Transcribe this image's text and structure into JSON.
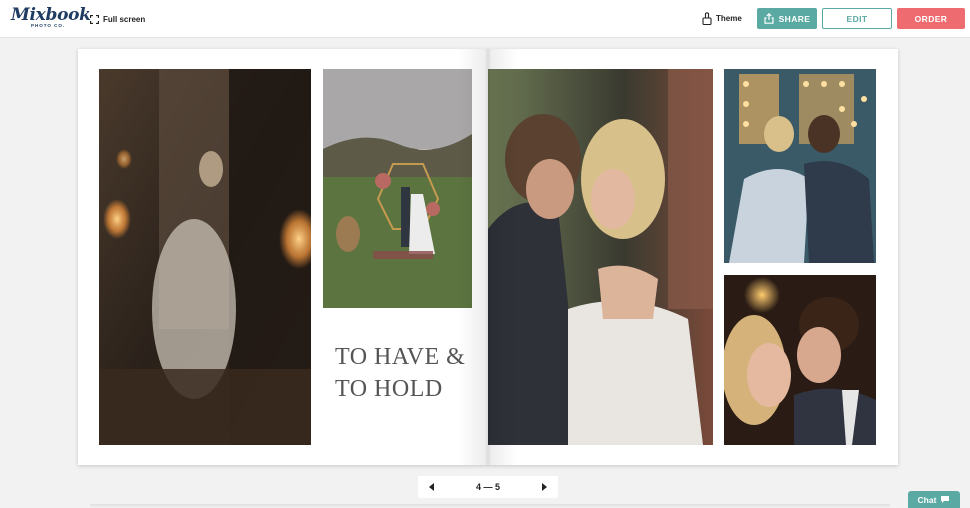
{
  "brand": {
    "logo_text": "Mixbook",
    "logo_subtext": "PHOTO CO."
  },
  "toolbar": {
    "fullscreen_label": "Full screen",
    "theme_label": "Theme",
    "share_label": "SHARE",
    "edit_label": "EDIT",
    "order_label": "ORDER"
  },
  "book": {
    "caption_line1": "TO HAVE &",
    "caption_line2": "TO HOLD"
  },
  "pager": {
    "page_range": "4 — 5"
  },
  "chat": {
    "label": "Chat"
  },
  "colors": {
    "accent": "#5aa9a3",
    "order": "#ee6b6f",
    "brand_navy": "#1f3c63",
    "background": "#f2f2f2"
  },
  "icons": {
    "fullscreen": "fullscreen-icon",
    "theme": "paint-bucket-icon",
    "share": "share-icon",
    "prev": "triangle-left-icon",
    "next": "triangle-right-icon",
    "chat": "speech-bubble-icon"
  }
}
